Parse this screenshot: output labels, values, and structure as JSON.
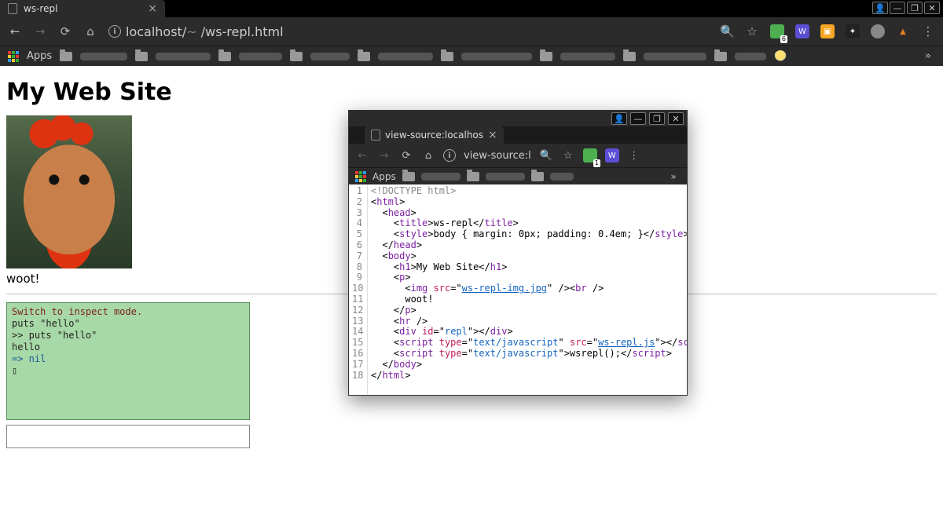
{
  "outer": {
    "tab_title": "ws-repl",
    "url_host": "localhost/",
    "url_mid_blur": "~        ",
    "url_path": "/ws-repl.html",
    "apps_label": "Apps",
    "ext_badge_green": "6"
  },
  "page": {
    "h1": "My Web Site",
    "woot": "woot!"
  },
  "repl": {
    "motd": "Switch to inspect mode.",
    "line1": "puts \"hello\"",
    "line2": ">> puts \"hello\"",
    "line3": "hello",
    "line4": "=> nil",
    "cursor": "▯"
  },
  "popup": {
    "tab_title": "view-source:localhos",
    "addr_prefix": "view-source:l",
    "apps_label": "Apps",
    "ext_badge_green": "1",
    "source_lines": 18,
    "source": {
      "l1": "<!DOCTYPE html>",
      "l2_open": "<",
      "l2_tag": "html",
      "l2_close": ">",
      "l3_open": "<",
      "l3_tag": "head",
      "l3_close": ">",
      "l4_open": "<",
      "l4_tag": "title",
      "l4_mid": ">ws-repl</",
      "l4_tag2": "title",
      "l4_end": ">",
      "l5_open": "<",
      "l5_tag": "style",
      "l5_mid": ">body { margin: 0px; padding: 0.4em; }</",
      "l5_tag2": "style",
      "l5_end": ">",
      "l6_open": "</",
      "l6_tag": "head",
      "l6_close": ">",
      "l7_open": "<",
      "l7_tag": "body",
      "l7_close": ">",
      "l8_open": "<",
      "l8_tag": "h1",
      "l8_mid": ">My Web Site</",
      "l8_tag2": "h1",
      "l8_end": ">",
      "l9_open": "<",
      "l9_tag": "p",
      "l9_close": ">",
      "l10_open": "<",
      "l10_tag": "img",
      "l10_sp": " ",
      "l10_attr": "src",
      "l10_eq": "=\"",
      "l10_link": "ws-repl-img.jpg",
      "l10_q": "\"",
      "l10_mid": " /><",
      "l10_tag2": "br",
      "l10_end": " />",
      "l11": "woot!",
      "l12_open": "</",
      "l12_tag": "p",
      "l12_close": ">",
      "l13_open": "<",
      "l13_tag": "hr",
      "l13_close": " />",
      "l14_open": "<",
      "l14_tag": "div",
      "l14_sp": " ",
      "l14_attr": "id",
      "l14_eq": "=\"",
      "l14_val": "repl",
      "l14_mid": "\"></",
      "l14_tag2": "div",
      "l14_end": ">",
      "l15_open": "<",
      "l15_tag": "script",
      "l15_sp": " ",
      "l15_attr1": "type",
      "l15_eq1": "=\"",
      "l15_val1": "text/javascript",
      "l15_q1": "\" ",
      "l15_attr2": "src",
      "l15_eq2": "=\"",
      "l15_link": "ws-repl.js",
      "l15_mid": "\"></",
      "l15_tag2": "script",
      "l15_end": ">",
      "l16_open": "<",
      "l16_tag": "script",
      "l16_sp": " ",
      "l16_attr": "type",
      "l16_eq": "=\"",
      "l16_val": "text/javascript",
      "l16_mid": "\">wsrepl();</",
      "l16_tag2": "script",
      "l16_end": ">",
      "l17_open": "</",
      "l17_tag": "body",
      "l17_close": ">",
      "l18_open": "</",
      "l18_tag": "html",
      "l18_close": ">"
    }
  }
}
